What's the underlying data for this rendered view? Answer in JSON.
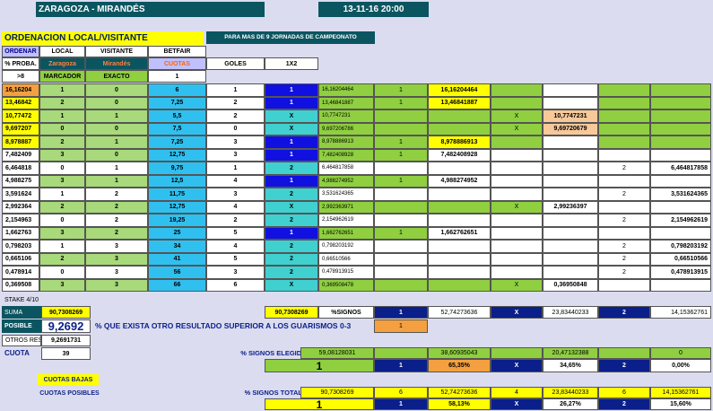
{
  "header": {
    "match": "ZARAGOZA - MIRANDÉS",
    "date_time": "13-11-16   20:00"
  },
  "subtitle": {
    "title": "ORDENACION LOCAL/VISITANTE",
    "note": "PARA MAS DE 9 JORNADAS DE CAMPEONATO"
  },
  "colhead": {
    "ordenar": "ORDENAR",
    "local": "LOCAL",
    "visitante": "VISITANTE",
    "betfair": "BETFAIR",
    "proba": "% PROBA.",
    "zaragoza": "Zaragoza",
    "mirandes": "Mirandés",
    "cuotas": "CUOTAS",
    "goles": "GOLES",
    "x12": "1X2",
    "gt8": ">8",
    "marcador": "MARCADOR",
    "exacto": "EXACTO",
    "one": "1"
  },
  "rows": [
    {
      "p": "16,16204",
      "l": "1",
      "v": "0",
      "q": "6",
      "g": "1",
      "s": "1",
      "f": "16,16204464",
      "a": "1",
      "b": "16,16204464",
      "c": "",
      "d": "",
      "e": "",
      "h": ""
    },
    {
      "p": "13,46842",
      "l": "2",
      "v": "0",
      "q": "7,25",
      "g": "2",
      "s": "1",
      "f": "13,46841887",
      "a": "1",
      "b": "13,46841887",
      "c": "",
      "d": "",
      "e": "",
      "h": ""
    },
    {
      "p": "10,77472",
      "l": "1",
      "v": "1",
      "q": "5,5",
      "g": "2",
      "s": "X",
      "f": "10,7747231",
      "a": "",
      "b": "",
      "c": "X",
      "d": "10,7747231",
      "e": "",
      "h": ""
    },
    {
      "p": "9,697207",
      "l": "0",
      "v": "0",
      "q": "7,5",
      "g": "0",
      "s": "X",
      "f": "9,697206786",
      "a": "",
      "b": "",
      "c": "X",
      "d": "9,69720679",
      "e": "",
      "h": ""
    },
    {
      "p": "8,978887",
      "l": "2",
      "v": "1",
      "q": "7,25",
      "g": "3",
      "s": "1",
      "f": "8,978886913",
      "a": "1",
      "b": "8,978886913",
      "c": "",
      "d": "",
      "e": "",
      "h": ""
    },
    {
      "p": "7,482409",
      "l": "3",
      "v": "0",
      "q": "12,75",
      "g": "3",
      "s": "1",
      "f": "7,482408928",
      "a": "1",
      "b": "7,482408928",
      "c": "",
      "d": "",
      "e": "",
      "h": ""
    },
    {
      "p": "6,464818",
      "l": "0",
      "v": "1",
      "q": "9,75",
      "g": "1",
      "s": "2",
      "f": "6,464817858",
      "a": "",
      "b": "",
      "c": "",
      "d": "",
      "e": "2",
      "h": "6,464817858"
    },
    {
      "p": "4,988275",
      "l": "3",
      "v": "1",
      "q": "12,5",
      "g": "4",
      "s": "1",
      "f": "4,988274952",
      "a": "1",
      "b": "4,988274952",
      "c": "",
      "d": "",
      "e": "",
      "h": ""
    },
    {
      "p": "3,591624",
      "l": "1",
      "v": "2",
      "q": "11,75",
      "g": "3",
      "s": "2",
      "f": "3,531624365",
      "a": "",
      "b": "",
      "c": "",
      "d": "",
      "e": "2",
      "h": "3,531624365"
    },
    {
      "p": "2,992364",
      "l": "2",
      "v": "2",
      "q": "12,75",
      "g": "4",
      "s": "X",
      "f": "2,992363971",
      "a": "",
      "b": "",
      "c": "X",
      "d": "2,99236397",
      "e": "",
      "h": ""
    },
    {
      "p": "2,154963",
      "l": "0",
      "v": "2",
      "q": "19,25",
      "g": "2",
      "s": "2",
      "f": "2,154962619",
      "a": "",
      "b": "",
      "c": "",
      "d": "",
      "e": "2",
      "h": "2,154962619"
    },
    {
      "p": "1,662763",
      "l": "3",
      "v": "2",
      "q": "25",
      "g": "5",
      "s": "1",
      "f": "1,662762651",
      "a": "1",
      "b": "1,662762651",
      "c": "",
      "d": "",
      "e": "",
      "h": ""
    },
    {
      "p": "0,798203",
      "l": "1",
      "v": "3",
      "q": "34",
      "g": "4",
      "s": "2",
      "f": "0,798203192",
      "a": "",
      "b": "",
      "c": "",
      "d": "",
      "e": "2",
      "h": "0,798203192"
    },
    {
      "p": "0,665106",
      "l": "2",
      "v": "3",
      "q": "41",
      "g": "5",
      "s": "2",
      "f": "0,66510566",
      "a": "",
      "b": "",
      "c": "",
      "d": "",
      "e": "2",
      "h": "0,66510566"
    },
    {
      "p": "0,478914",
      "l": "0",
      "v": "3",
      "q": "56",
      "g": "3",
      "s": "2",
      "f": "0,478913915",
      "a": "",
      "b": "",
      "c": "",
      "d": "",
      "e": "2",
      "h": "0,478913915"
    },
    {
      "p": "0,369508",
      "l": "3",
      "v": "3",
      "q": "66",
      "g": "6",
      "s": "X",
      "f": "0,369508478",
      "a": "",
      "b": "",
      "c": "X",
      "d": "0,36950848",
      "e": "",
      "h": ""
    }
  ],
  "stake": "STAKE 4/10",
  "suma": {
    "label": "SUMA",
    "value": "90,7308269",
    "v2": "90,7308269",
    "signos": "%SIGNOS",
    "one": "1",
    "v1": "52,74273636",
    "x": "X",
    "vx": "23,83440233",
    "two": "2",
    "v2b": "14,15362761"
  },
  "posible": {
    "label": "POSIBLE",
    "value": "9,2692",
    "text": "% QUE EXISTA OTRO RESULTADO SUPERIOR A LOS GUARISMOS 0-3",
    "one": "1"
  },
  "otros": {
    "label": "OTROS RESU",
    "value": "9,2691731"
  },
  "cuota": {
    "label": "CUOTA",
    "value": "39"
  },
  "elegidos": {
    "label": "% SIGNOS ELEGIDOS",
    "v0": "59,08128031",
    "v1": "38,60935043",
    "vx": "20,47132388",
    "v2": "0",
    "big": "1",
    "one": "1",
    "p1": "65,35%",
    "x": "X",
    "px": "34,65%",
    "two": "2",
    "p2": "0,00%"
  },
  "bajas": "CUOTAS BAJAS",
  "posibles": "CUOTAS POSIBLES",
  "totales": {
    "label": "% SIGNOS TOTALES",
    "v0": "90,7308269",
    "n6": "6",
    "v1": "52,74273636",
    "n4": "4",
    "vx": "23,83440233",
    "n6b": "6",
    "v2": "14,15362761",
    "big": "1",
    "one": "1",
    "p1": "58,13%",
    "x": "X",
    "px": "26,27%",
    "two": "2",
    "p2": "15,60%"
  },
  "colors": {
    "dark_teal": "#0b5560",
    "navy": "#0a1f8a",
    "yellow": "#ffff00",
    "green": "#8fcf40",
    "sky": "#30c0f0",
    "teal": "#40d0d0",
    "orange": "#f4a040"
  }
}
